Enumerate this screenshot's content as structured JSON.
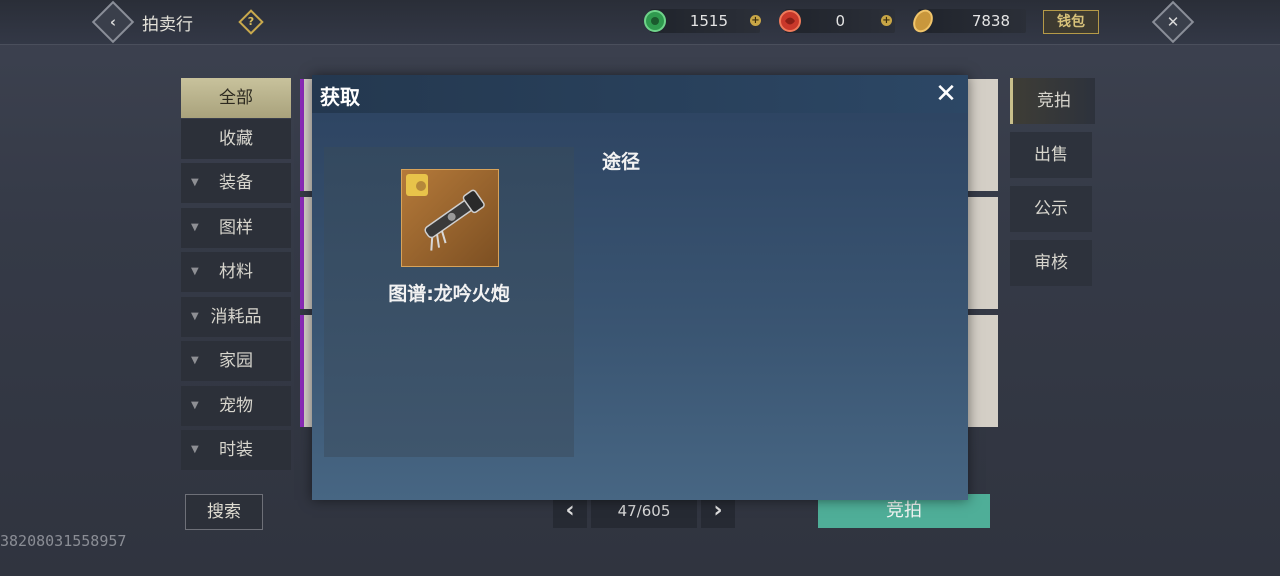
{
  "header": {
    "title": "拍卖行",
    "help_icon": "?",
    "back_icon": "‹",
    "currencies": [
      {
        "name": "jade-coin",
        "value": "1515",
        "color": "#3aa65a"
      },
      {
        "name": "red-gem",
        "value": "0",
        "color": "#d03a2a"
      },
      {
        "name": "gold-coin",
        "value": "7838",
        "color": "#c89a3e"
      }
    ],
    "wallet_label": "钱包",
    "close_icon": "✕"
  },
  "categories": [
    {
      "label": "全部",
      "active": true,
      "chevron": false
    },
    {
      "label": "收藏",
      "active": false,
      "chevron": false
    },
    {
      "label": "装备",
      "active": false,
      "chevron": true
    },
    {
      "label": "图样",
      "active": false,
      "chevron": true
    },
    {
      "label": "材料",
      "active": false,
      "chevron": true
    },
    {
      "label": "消耗品",
      "active": false,
      "chevron": true
    },
    {
      "label": "家园",
      "active": false,
      "chevron": true
    },
    {
      "label": "宠物",
      "active": false,
      "chevron": true
    },
    {
      "label": "时装",
      "active": false,
      "chevron": true
    }
  ],
  "right_tabs": [
    {
      "label": "竞拍",
      "active": true
    },
    {
      "label": "出售",
      "active": false
    },
    {
      "label": "公示",
      "active": false
    },
    {
      "label": "审核",
      "active": false
    }
  ],
  "modal": {
    "title": "获取",
    "close_icon": "✕",
    "item_name": "图谱:龙吟火炮",
    "route_label": "途径"
  },
  "bottom": {
    "search_label": "搜索",
    "page_text": "47/605",
    "prev_icon": "‹",
    "next_icon": "›",
    "bid_label": "竞拍"
  },
  "uid": "38208031558957"
}
